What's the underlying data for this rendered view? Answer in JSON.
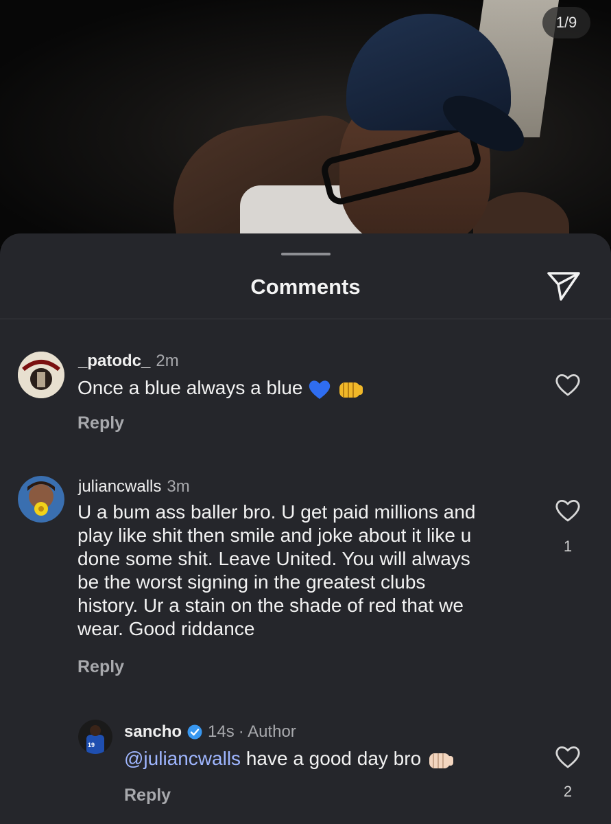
{
  "media": {
    "counter": "1/9"
  },
  "sheet": {
    "title": "Comments"
  },
  "comments": [
    {
      "username": "_patodc_",
      "time": "2m",
      "text": "Once a blue always a blue",
      "emojis": [
        "blue-heart",
        "fist-bump"
      ],
      "reply_label": "Reply",
      "likes": ""
    },
    {
      "username": "juliancwalls",
      "time": "3m",
      "text_lines": [
        "U a bum ass baller bro. U get paid millions and",
        "play like shit then smile and joke about it like u",
        "done some shit. Leave United. You will always",
        "be the worst signing in the greatest clubs",
        "history. Ur a stain on the shade of red that we",
        "wear. Good riddance"
      ],
      "reply_label": "Reply",
      "likes": "1"
    },
    {
      "username": "sancho",
      "verified": true,
      "time": "14s",
      "author_label": "· Author",
      "mention": "@juliancwalls",
      "text": " have a good day bro",
      "emojis": [
        "fist-bump-light"
      ],
      "reply_label": "Reply",
      "likes": "2"
    }
  ],
  "colors": {
    "sheet_bg": "#25262b",
    "mention": "#9fb6ff",
    "meta": "#a8a9ad",
    "verified": "#3897f0"
  }
}
